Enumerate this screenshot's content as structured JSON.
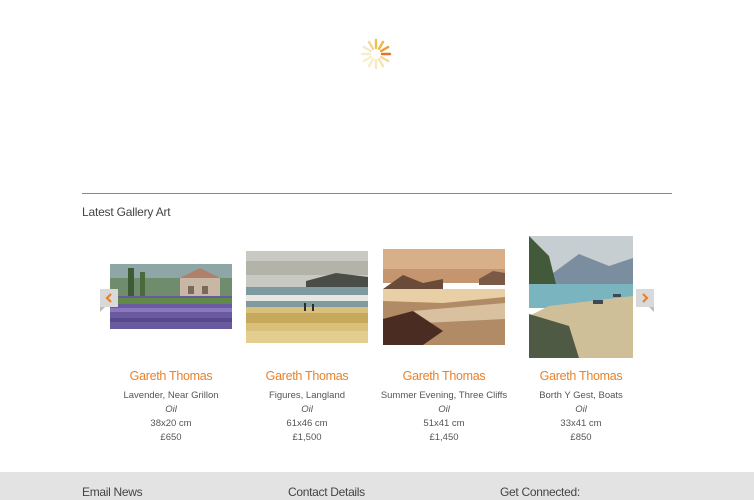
{
  "section": {
    "title": "Latest Gallery Art"
  },
  "carousel": {
    "prev_icon": "chevron-left-icon",
    "next_icon": "chevron-right-icon",
    "accent": "#e8812a",
    "items": [
      {
        "artist": "Gareth Thomas",
        "title": "Lavender, Near Grillon",
        "medium": "Oil",
        "size": "38x20 cm",
        "price": "£650"
      },
      {
        "artist": "Gareth Thomas",
        "title": "Figures, Langland",
        "medium": "Oil",
        "size": "61x46 cm",
        "price": "£1,500"
      },
      {
        "artist": "Gareth Thomas",
        "title": "Summer Evening, Three Cliffs",
        "medium": "Oil",
        "size": "51x41 cm",
        "price": "£1,450"
      },
      {
        "artist": "Gareth Thomas",
        "title": "Borth Y Gest, Boats",
        "medium": "Oil",
        "size": "33x41 cm",
        "price": "£850"
      }
    ]
  },
  "footer": {
    "email_news": "Email News",
    "contact_details": "Contact Details",
    "get_connected": "Get Connected:"
  }
}
